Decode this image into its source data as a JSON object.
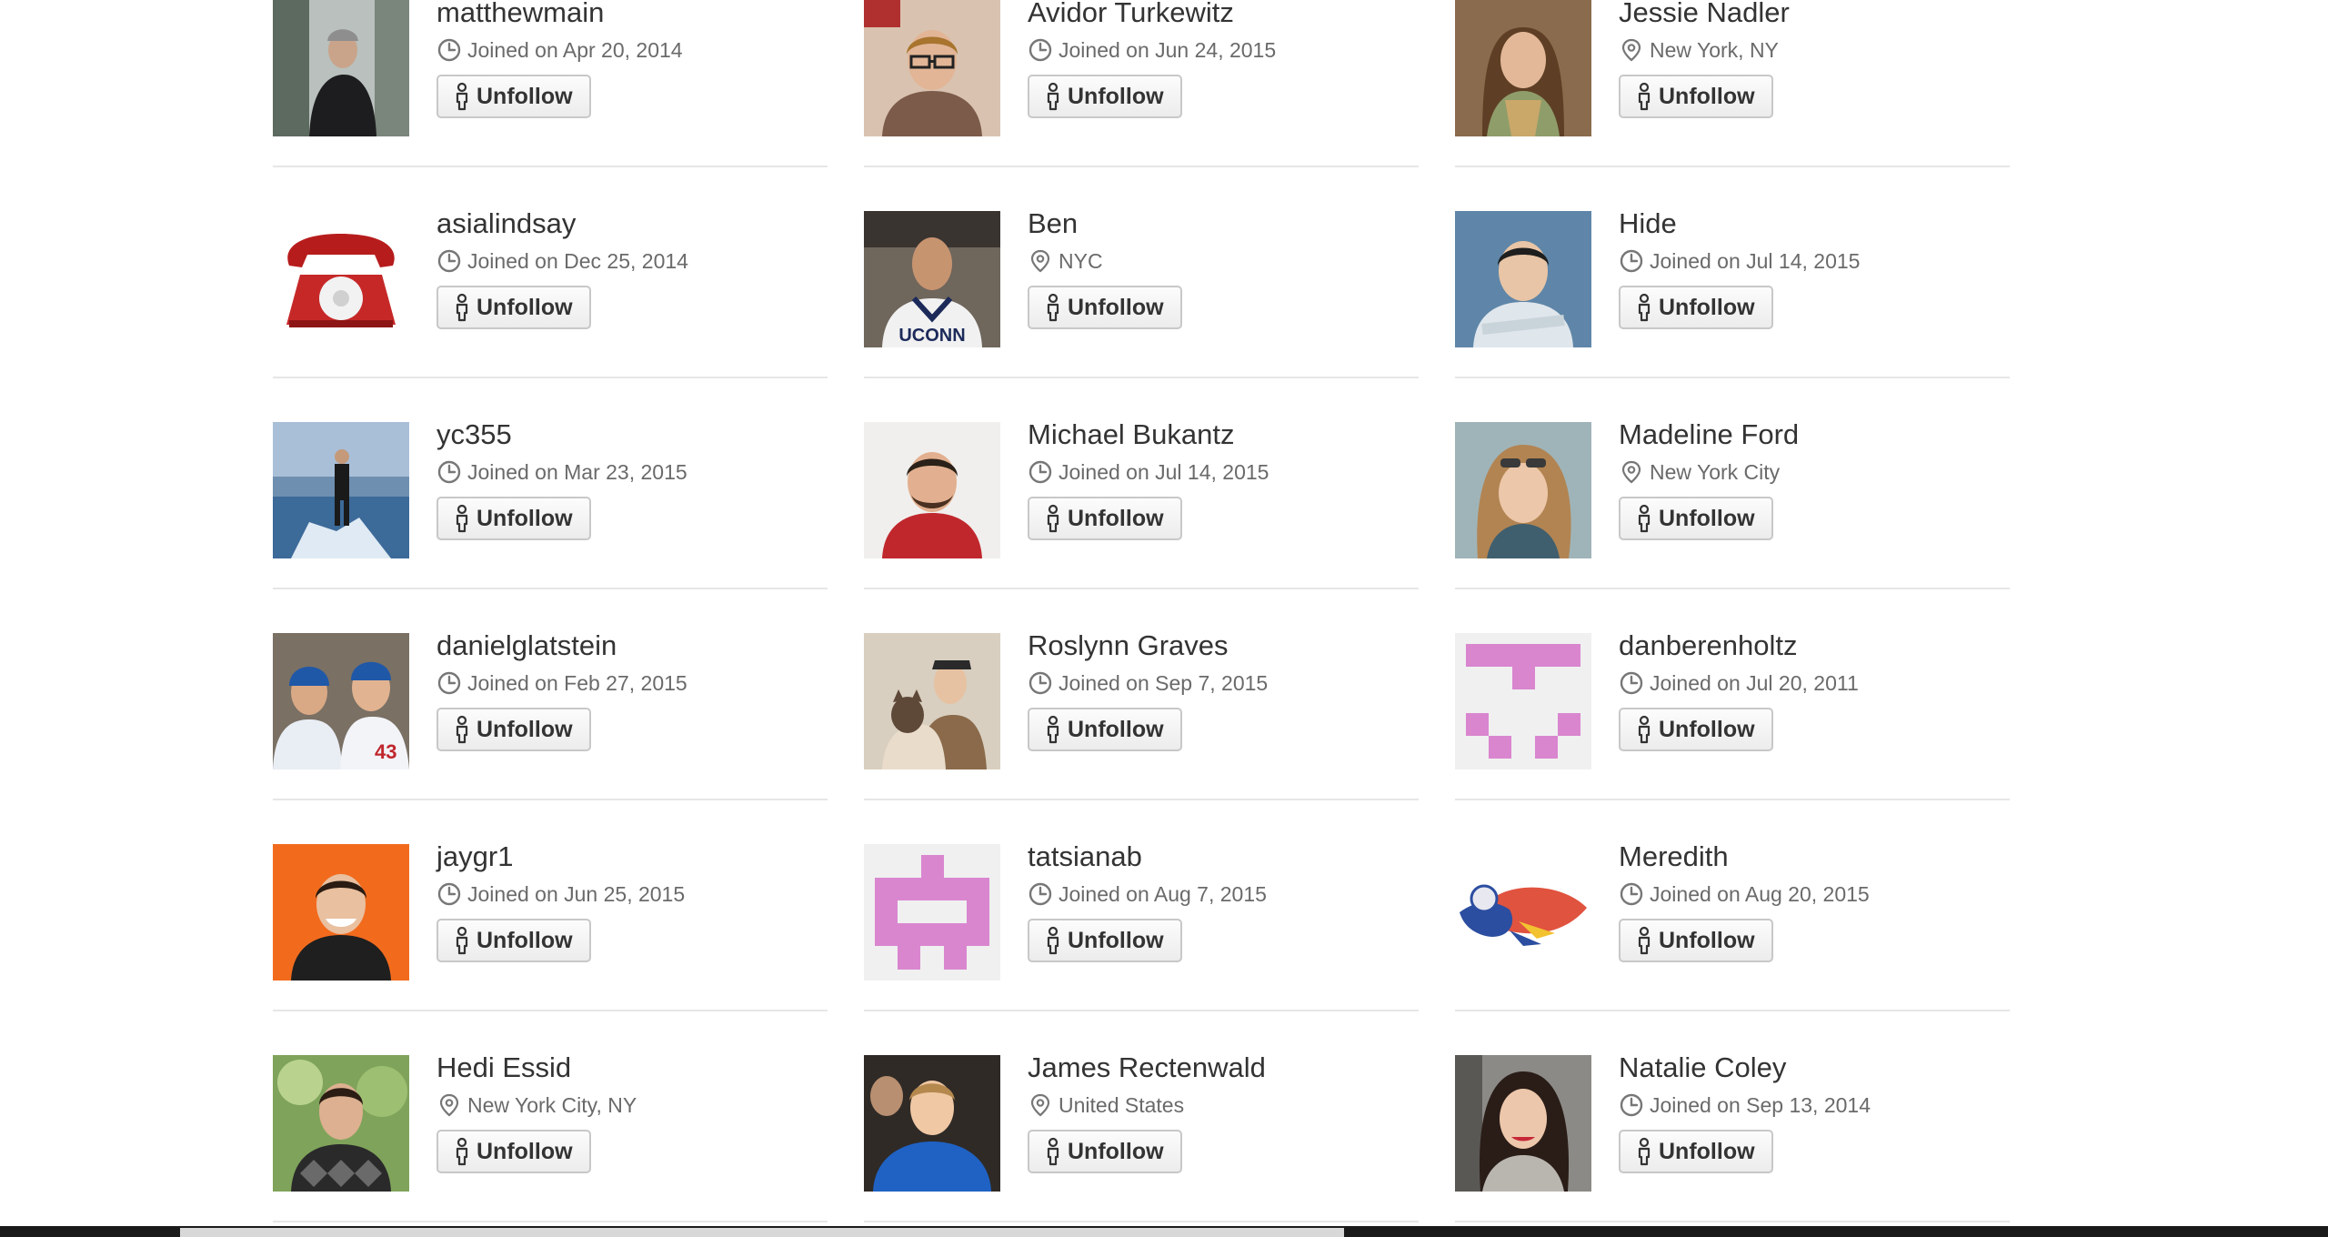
{
  "follow_button_label": "Unfollow",
  "users": [
    {
      "name": "matthewmain",
      "meta_icon": "clock-icon",
      "meta_text": "Joined on Apr 20, 2014",
      "avatar": "photo-man-dark-coat"
    },
    {
      "name": "Avidor Turkewitz",
      "meta_icon": "clock-icon",
      "meta_text": "Joined on Jun 24, 2015",
      "avatar": "photo-man-glasses"
    },
    {
      "name": "Jessie Nadler",
      "meta_icon": "location-pin-icon",
      "meta_text": "New York, NY",
      "avatar": "photo-woman-scarf"
    },
    {
      "name": "asialindsay",
      "meta_icon": "clock-icon",
      "meta_text": "Joined on Dec 25, 2014",
      "avatar": "photo-red-telephone"
    },
    {
      "name": "Ben",
      "meta_icon": "location-pin-icon",
      "meta_text": "NYC",
      "avatar": "photo-basketball-player"
    },
    {
      "name": "Hide",
      "meta_icon": "clock-icon",
      "meta_text": "Joined on Jul 14, 2015",
      "avatar": "photo-man-blue-wall"
    },
    {
      "name": "yc355",
      "meta_icon": "clock-icon",
      "meta_text": "Joined on Mar 23, 2015",
      "avatar": "photo-man-on-ice"
    },
    {
      "name": "Michael Bukantz",
      "meta_icon": "clock-icon",
      "meta_text": "Joined on Jul 14, 2015",
      "avatar": "photo-man-smiling-red"
    },
    {
      "name": "Madeline Ford",
      "meta_icon": "location-pin-icon",
      "meta_text": "New York City",
      "avatar": "photo-woman-sunglasses"
    },
    {
      "name": "danielglatstein",
      "meta_icon": "clock-icon",
      "meta_text": "Joined on Feb 27, 2015",
      "avatar": "photo-couple-dodgers"
    },
    {
      "name": "Roslynn Graves",
      "meta_icon": "clock-icon",
      "meta_text": "Joined on Sep 7, 2015",
      "avatar": "photo-woman-with-cat"
    },
    {
      "name": "danberenholtz",
      "meta_icon": "clock-icon",
      "meta_text": "Joined on Jul 20, 2011",
      "avatar": "identicon-face"
    },
    {
      "name": "jaygr1",
      "meta_icon": "clock-icon",
      "meta_text": "Joined on Jun 25, 2015",
      "avatar": "photo-man-orange-bg"
    },
    {
      "name": "tatsianab",
      "meta_icon": "clock-icon",
      "meta_text": "Joined on Aug 7, 2015",
      "avatar": "identicon-robot"
    },
    {
      "name": "Meredith",
      "meta_icon": "clock-icon",
      "meta_text": "Joined on Aug 20, 2015",
      "avatar": "illustration-flying-creature"
    },
    {
      "name": "Hedi Essid",
      "meta_icon": "location-pin-icon",
      "meta_text": "New York City, NY",
      "avatar": "photo-man-argyle-sweater"
    },
    {
      "name": "James Rectenwald",
      "meta_icon": "location-pin-icon",
      "meta_text": "United States",
      "avatar": "photo-man-blue-shirt"
    },
    {
      "name": "Natalie Coley",
      "meta_icon": "clock-icon",
      "meta_text": "Joined on Sep 13, 2014",
      "avatar": "photo-woman-street"
    }
  ],
  "colors": {
    "text_primary": "#333333",
    "text_secondary": "#6a6a6a",
    "divider": "#e6e6e6",
    "button_border": "#c8c8c8",
    "identicon_pink": "#d986cf"
  }
}
